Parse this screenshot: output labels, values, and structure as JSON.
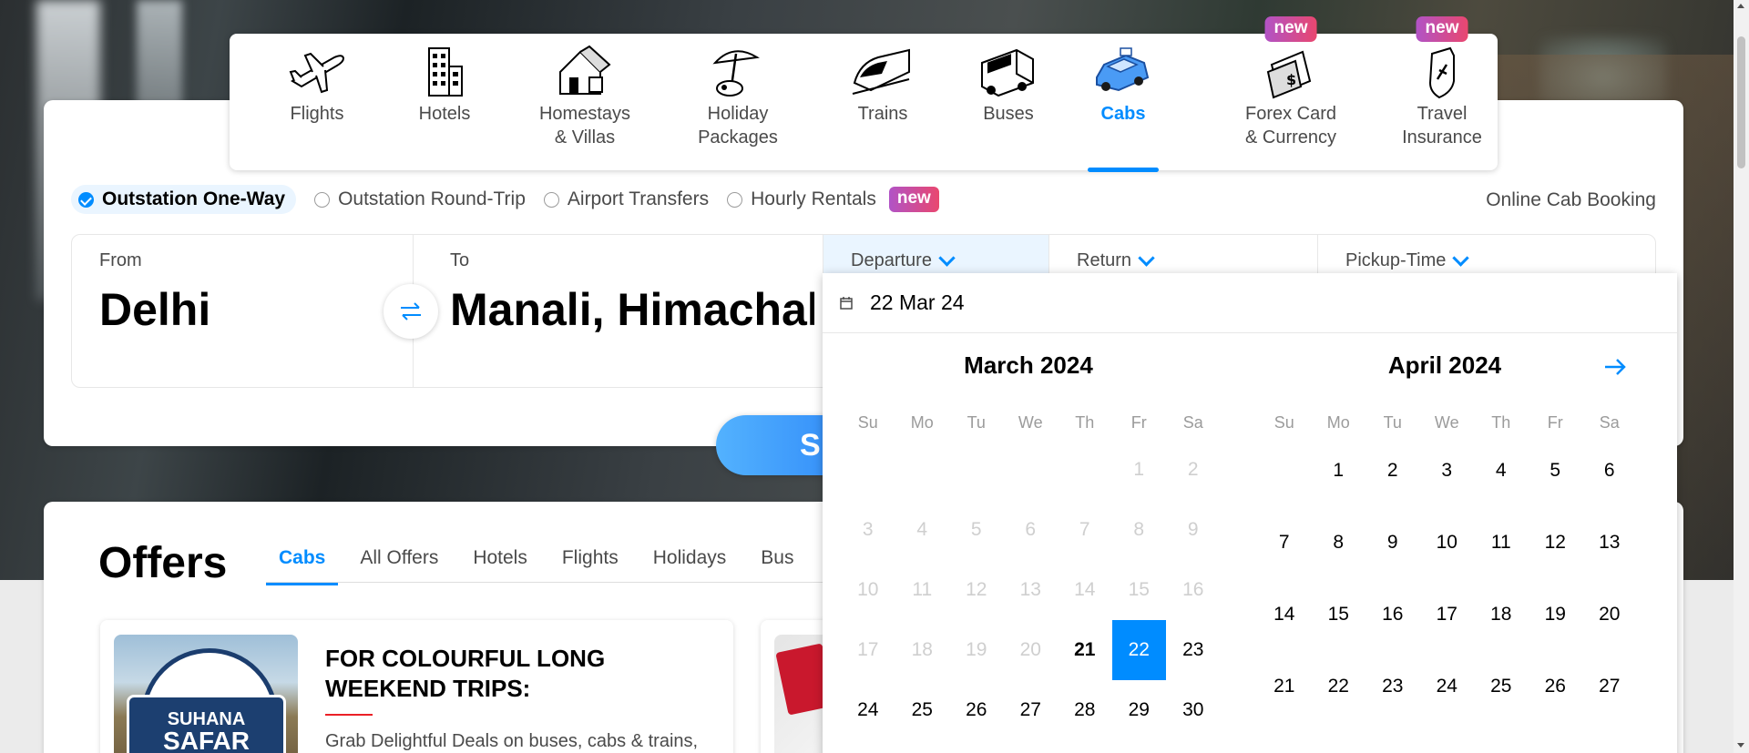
{
  "nav": {
    "items": [
      {
        "label": "Flights",
        "icon": "airplane-icon",
        "badge": ""
      },
      {
        "label": "Hotels",
        "icon": "hotel-building-icon",
        "badge": ""
      },
      {
        "label": "Homestays\n& Villas",
        "icon": "house-icon",
        "badge": ""
      },
      {
        "label": "Holiday\nPackages",
        "icon": "beach-umbrella-icon",
        "badge": ""
      },
      {
        "label": "Trains",
        "icon": "train-icon",
        "badge": ""
      },
      {
        "label": "Buses",
        "icon": "bus-icon",
        "badge": ""
      },
      {
        "label": "Cabs",
        "icon": "cab-icon",
        "badge": ""
      },
      {
        "label": "Forex Card\n& Currency",
        "icon": "forex-card-icon",
        "badge": "new"
      },
      {
        "label": "Travel\nInsurance",
        "icon": "insurance-shield-icon",
        "badge": "new"
      }
    ],
    "active": "Cabs"
  },
  "trip_types": {
    "options": [
      "Outstation One-Way",
      "Outstation Round-Trip",
      "Airport Transfers",
      "Hourly Rentals"
    ],
    "selected": "Outstation One-Way",
    "hourly_badge": "new"
  },
  "online_cab_label": "Online Cab Booking",
  "fields": {
    "from_label": "From",
    "from_value": "Delhi",
    "to_label": "To",
    "to_value": "Manali, Himachal Pradesh",
    "departure_label": "Departure",
    "return_label": "Return",
    "pickup_label": "Pickup-Time"
  },
  "search_button": "SEARCH",
  "calendar": {
    "input_value": "22 Mar 24",
    "weekdays": [
      "Su",
      "Mo",
      "Tu",
      "We",
      "Th",
      "Fr",
      "Sa"
    ],
    "months": [
      {
        "name": "March 2024",
        "weeks": [
          [
            "",
            "",
            "",
            "",
            "",
            "1",
            "2"
          ],
          [
            "3",
            "4",
            "5",
            "6",
            "7",
            "8",
            "9"
          ],
          [
            "10",
            "11",
            "12",
            "13",
            "14",
            "15",
            "16"
          ],
          [
            "17",
            "18",
            "19",
            "20",
            "21",
            "22",
            "23"
          ],
          [
            "24",
            "25",
            "26",
            "27",
            "28",
            "29",
            "30"
          ]
        ],
        "disabled_through": 20,
        "today": 21,
        "selected": 22
      },
      {
        "name": "April 2024",
        "weeks": [
          [
            "",
            "1",
            "2",
            "3",
            "4",
            "5",
            "6"
          ],
          [
            "7",
            "8",
            "9",
            "10",
            "11",
            "12",
            "13"
          ],
          [
            "14",
            "15",
            "16",
            "17",
            "18",
            "19",
            "20"
          ],
          [
            "21",
            "22",
            "23",
            "24",
            "25",
            "26",
            "27"
          ]
        ],
        "disabled_through": 0,
        "today": 0,
        "selected": 0
      }
    ]
  },
  "offers": {
    "title": "Offers",
    "tabs": [
      "Cabs",
      "All Offers",
      "Hotels",
      "Flights",
      "Holidays",
      "Bus"
    ],
    "active_tab": "Cabs",
    "cards": [
      {
        "title": "FOR COLOURFUL LONG WEEKEND TRIPS:",
        "description": "Grab Delightful Deals on buses, cabs & trains,",
        "image_text_top": "SUHANA",
        "image_text_big": "SAFAR"
      }
    ]
  },
  "colors": {
    "accent": "#008cff",
    "badge_gradient_start": "#b153c6",
    "badge_gradient_end": "#e9476f",
    "selected_date": "#008cff"
  }
}
